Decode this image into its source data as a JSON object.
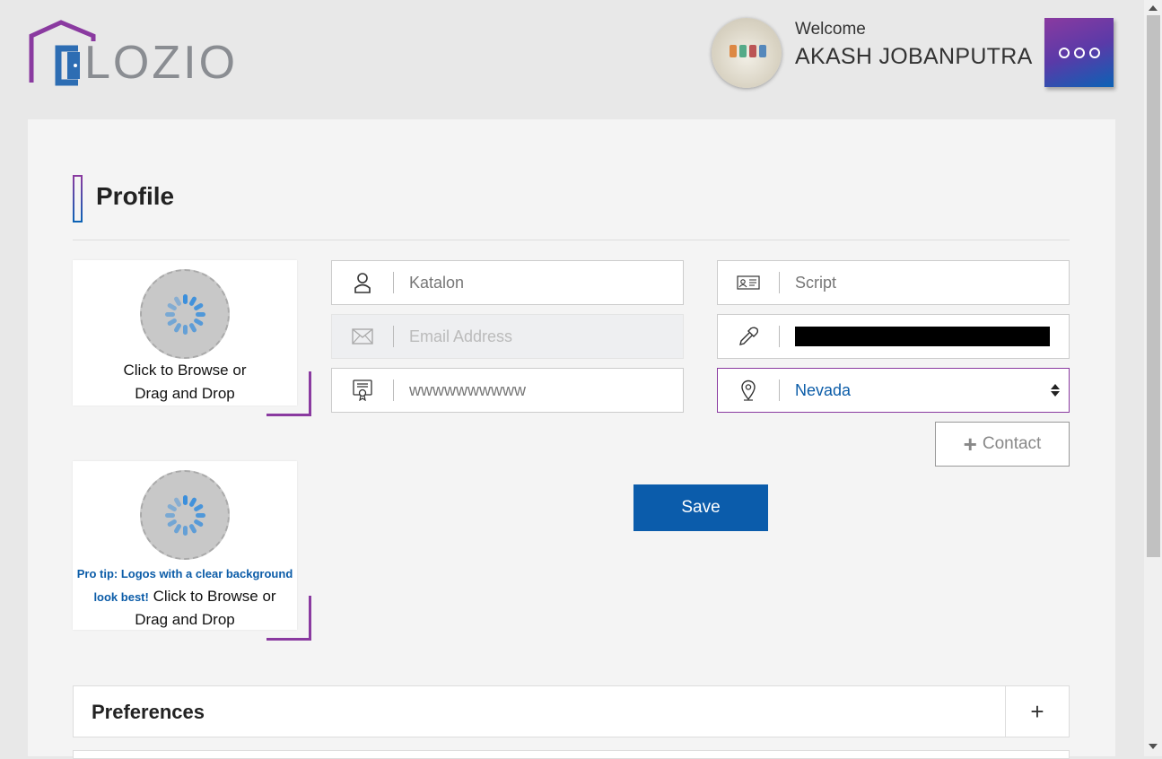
{
  "header": {
    "logo_text": "LOZIO",
    "welcome_label": "Welcome",
    "username": "AKASH JOBANPUTRA",
    "menu_icon": "more-dots-icon"
  },
  "profile": {
    "title": "Profile",
    "photo_upload": {
      "text_line1": "Click to Browse or",
      "text_line2": "Drag and Drop"
    },
    "logo_upload": {
      "pro_tip": "Pro tip: Logos with a clear background look best!",
      "text_line1": "Click to Browse or",
      "text_line2": "Drag and Drop"
    },
    "fields": {
      "first_name": {
        "icon": "user-icon",
        "placeholder": "Katalon"
      },
      "email": {
        "icon": "envelope-icon",
        "placeholder": "Email Address",
        "disabled": true
      },
      "website": {
        "icon": "certificate-icon",
        "placeholder": "wwwwwwwwww"
      },
      "last_name": {
        "icon": "id-card-icon",
        "placeholder": "Script"
      },
      "phone": {
        "icon": "eyedropper-icon",
        "value": "[redacted]"
      },
      "state": {
        "icon": "location-pin-icon",
        "value": "Nevada"
      }
    },
    "contact_button": "Contact",
    "save_button": "Save"
  },
  "accordion": {
    "preferences_label": "Preferences",
    "toggle": "+"
  },
  "colors": {
    "brand_purple": "#8a3aa0",
    "brand_blue": "#0b5cab",
    "link_blue": "#0b5ca8"
  }
}
